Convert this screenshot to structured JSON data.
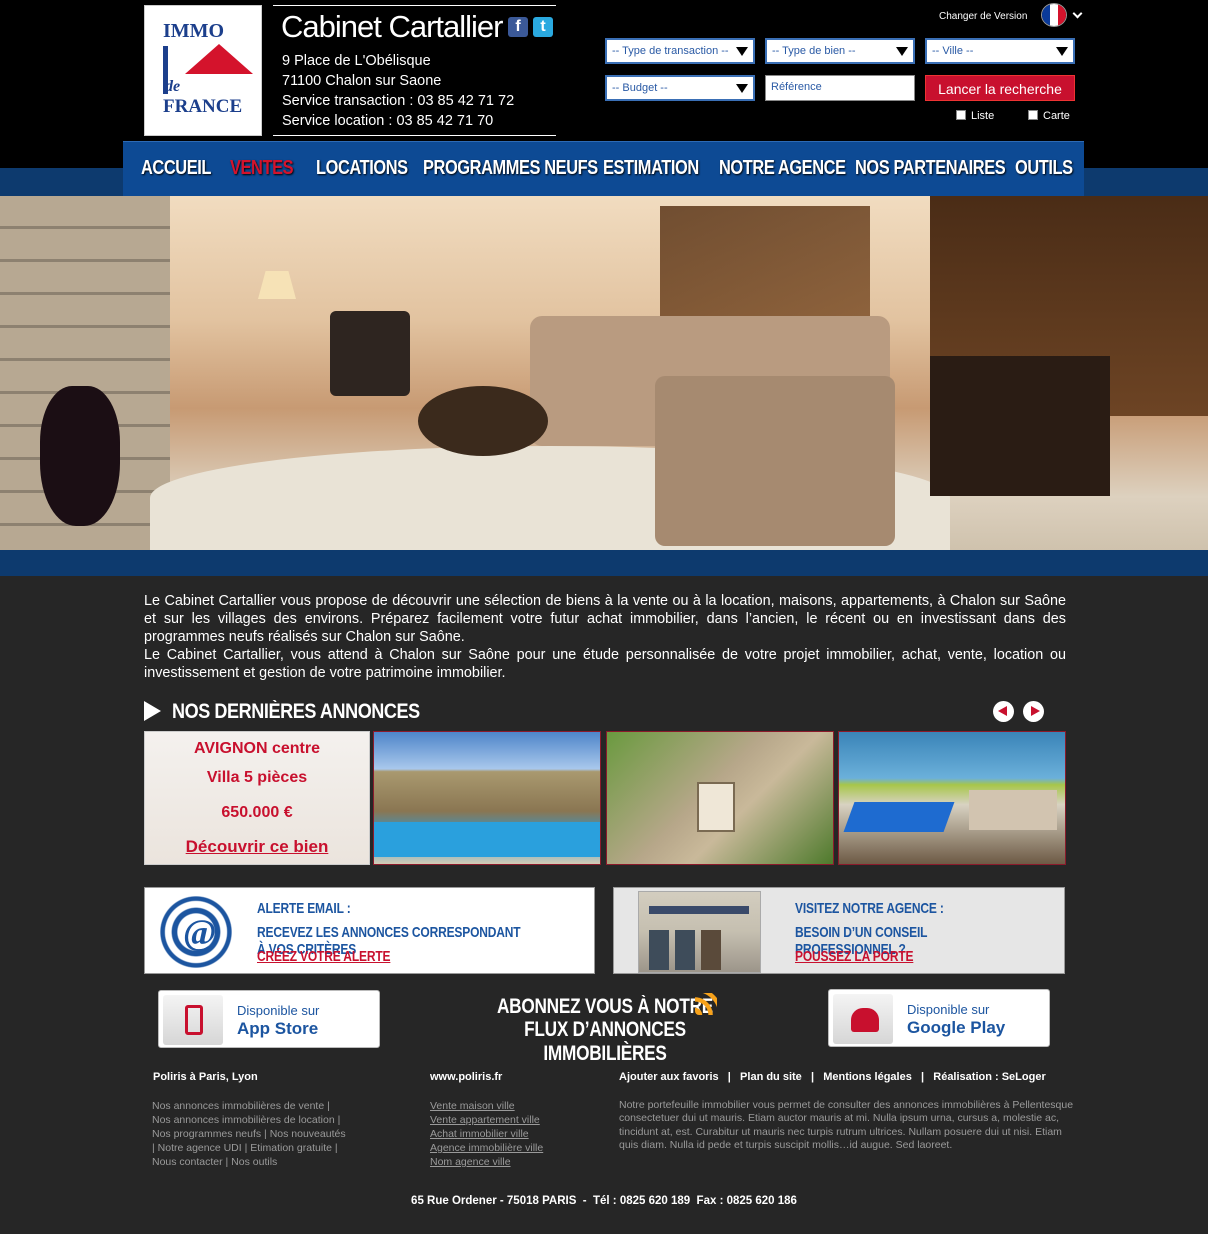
{
  "logo": {
    "immo": "IMMO",
    "de": "de",
    "france": "FRANCE"
  },
  "agency": {
    "name": "Cabinet Cartallier",
    "address1": "9 Place de L'Obélisque",
    "address2": "71100 Chalon sur Saone",
    "phone_transaction": "Service transaction : 03 85 42 71 72",
    "phone_location": "Service location : 03 85 42 71 70"
  },
  "social": {
    "facebook": "f",
    "twitter": "t"
  },
  "version": {
    "label": "Changer de Version"
  },
  "search": {
    "type_transaction": "-- Type de transaction --",
    "type_bien": "-- Type de bien --",
    "ville": "-- Ville --",
    "budget": "-- Budget --",
    "reference_placeholder": "Référence",
    "submit": "Lancer la recherche",
    "liste": "Liste",
    "carte": "Carte"
  },
  "nav": [
    {
      "label": "ACCUEIL"
    },
    {
      "label": "VENTES"
    },
    {
      "label": "LOCATIONS"
    },
    {
      "label": "PROGRAMMES NEUFS"
    },
    {
      "label": "ESTIMATION"
    },
    {
      "label": "NOTRE AGENCE"
    },
    {
      "label": "NOS PARTENAIRES"
    },
    {
      "label": "OUTILS"
    }
  ],
  "intro": "Le Cabinet Cartallier vous propose de découvrir une sélection de biens à la vente ou à la location, maisons, appartements, à Chalon sur Saône et sur les villages des environs. Préparez facilement votre futur achat immobilier, dans l’ancien, le récent ou en investissant dans des programmes neufs réalisés sur Chalon sur Saône.",
  "intro2": "Le Cabinet Cartallier, vous attend à Chalon sur Saône pour une étude personnalisée de votre projet immobilier, achat, vente, location ou investissement et gestion de votre patrimoine immobilier.",
  "annonces": {
    "title": "NOS DERNIÈRES ANNONCES",
    "card": {
      "city": "AVIGNON centre",
      "type": "Villa 5 pièces",
      "price": "650.000 €",
      "cta": "Découvrir ce bien"
    }
  },
  "alerte": {
    "title": "ALERTE EMAIL :",
    "text": "RECEVEZ LES ANNONCES CORRESPONDANT À VOS CRITÈRES",
    "link": "CRÉEZ VOTRE ALERTE"
  },
  "visite": {
    "title": "VISITEZ NOTRE AGENCE :",
    "text": "BESOIN D’UN CONSEIL PROFESSIONNEL ?",
    "link": "POUSSEZ LA PORTE"
  },
  "appstore": {
    "line1": "Disponible sur",
    "line2": "App Store"
  },
  "googleplay": {
    "line1": "Disponible sur",
    "line2": "Google Play"
  },
  "rss": {
    "line1": "ABONNEZ VOUS À NOTRE",
    "line2": "FLUX D’ANNONCES IMMOBILIÈRES"
  },
  "footer": {
    "col1_title": "Poliris à Paris, Lyon",
    "col1_lines": [
      "Nos annonces immobilières de vente |",
      "Nos annonces immobilières de location |",
      "Nos programmes neufs | Nos nouveautés",
      "| Notre agence UDI | Etimation gratuite |",
      "Nous contacter | Nos outils"
    ],
    "col2_title": "www.poliris.fr",
    "col2_links": [
      "Vente maison ville",
      "Vente appartement ville",
      "Achat immobilier ville",
      "Agence immobilière ville",
      "Nom agence ville"
    ],
    "col3_title": "Ajouter aux favoris   |   Plan du site   |   Mentions légales   |   Réalisation : SeLoger",
    "col3_text": "Notre portefeuille immobilier vous permet de consulter des annonces immobilières à Pellentesque consectetuer dui ut mauris. Etiam auctor mauris at mi. Nulla ipsum urna, cursus a, molestie ac, tincidunt at, est. Curabitur ut mauris nec turpis rutrum ultrices. Nullam posuere dui ut nisi. Etiam quis diam. Nulla id pede et turpis suscipit mollis…id augue. Sed laoreet.",
    "address": "65 Rue Ordener - 75018 PARIS  -  Tél : 0825 620 189  Fax : 0825 620 186"
  }
}
